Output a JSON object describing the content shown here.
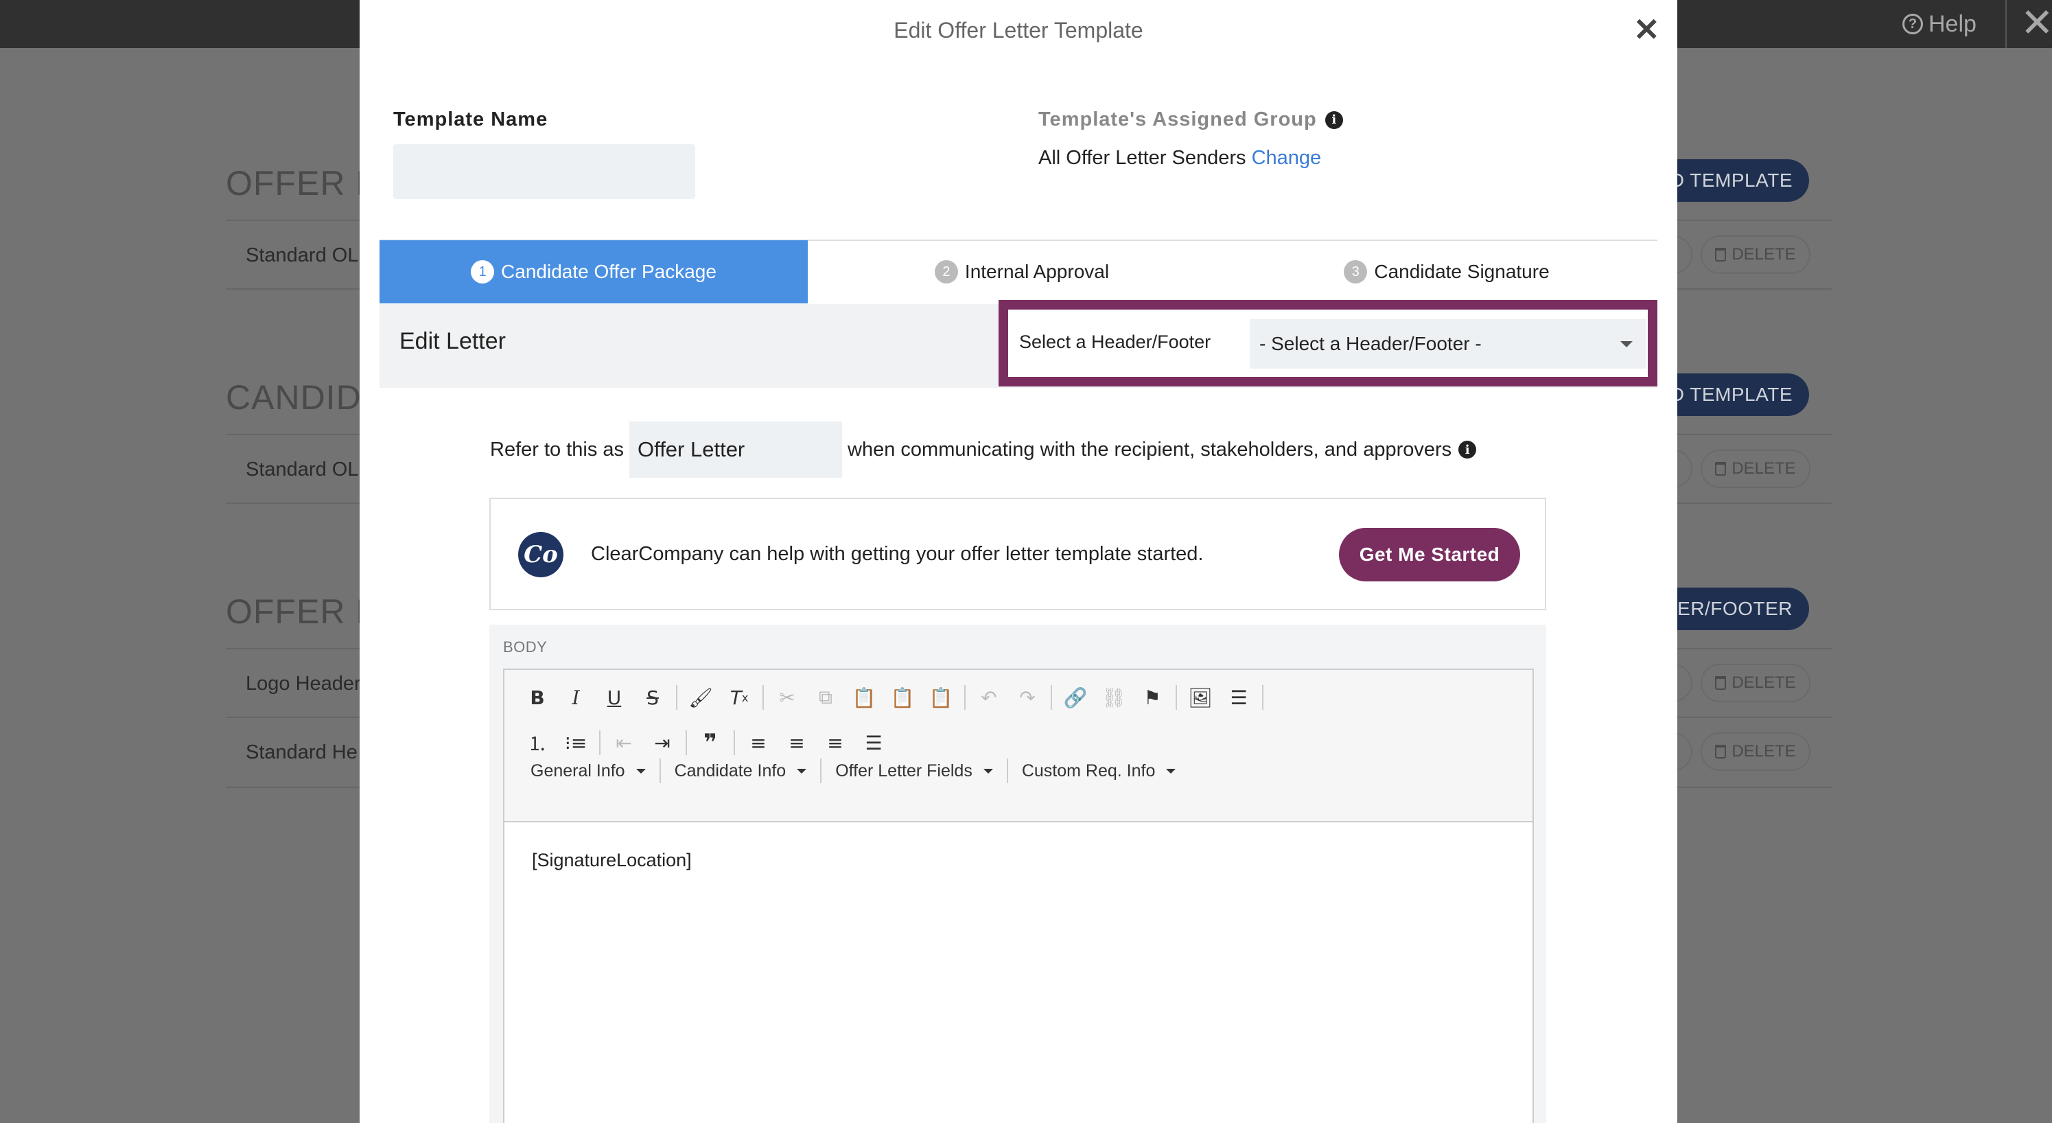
{
  "background": {
    "help_label": "Help",
    "sections": [
      {
        "title": "OFFER LE",
        "button": "DD TEMPLATE",
        "rows": [
          "Standard OL"
        ]
      },
      {
        "title": "CANDIDA",
        "button": "DD TEMPLATE",
        "rows": [
          "Standard OL"
        ]
      },
      {
        "title": "OFFER LE",
        "button": "ADER/FOOTER",
        "rows": [
          "Logo Header",
          "Standard He"
        ]
      }
    ],
    "delete_label": "DELETE"
  },
  "modal": {
    "title": "Edit Offer Letter Template",
    "template_name": {
      "label": "Template Name",
      "value": "",
      "placeholder": ""
    },
    "assigned_group": {
      "label": "Template's Assigned Group",
      "value": "All Offer Letter Senders",
      "change_link": "Change"
    },
    "tabs": [
      {
        "num": "1",
        "label": "Candidate Offer Package",
        "active": true
      },
      {
        "num": "2",
        "label": "Internal Approval",
        "active": false
      },
      {
        "num": "3",
        "label": "Candidate Signature",
        "active": false
      }
    ],
    "edit_letter_title": "Edit Letter",
    "header_footer": {
      "label": "Select a Header/Footer",
      "selected": "- Select a Header/Footer -"
    },
    "refer": {
      "prefix": "Refer to this as",
      "value": "Offer Letter",
      "suffix": "when communicating with the recipient, stakeholders, and approvers"
    },
    "clearcompany": {
      "logo_text": "Co",
      "message": "ClearCompany can help with getting your offer letter template started.",
      "button": "Get Me Started"
    },
    "body": {
      "label": "BODY",
      "dropdowns": [
        "General Info",
        "Candidate Info",
        "Offer Letter Fields",
        "Custom Req. Info"
      ],
      "content": "[SignatureLocation]"
    }
  },
  "colors": {
    "accent_tab": "#4a90e2",
    "brand": "#7a2e5f",
    "link": "#3a7bd5",
    "nav_button": "#1f2f4f"
  }
}
